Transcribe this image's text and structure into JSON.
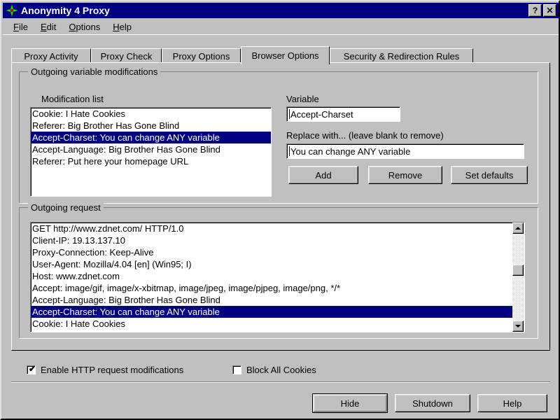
{
  "window": {
    "title": "Anonymity 4 Proxy",
    "icon": "compass-star-icon",
    "help_button": "?",
    "close_button": "✕",
    "titlebar_color": "#000080"
  },
  "menu": {
    "items": [
      {
        "label": "File",
        "accel": "F"
      },
      {
        "label": "Edit",
        "accel": "E"
      },
      {
        "label": "Options",
        "accel": "O"
      },
      {
        "label": "Help",
        "accel": "H"
      }
    ]
  },
  "tabs": [
    {
      "label": "Proxy Activity",
      "active": false
    },
    {
      "label": "Proxy Check",
      "active": false
    },
    {
      "label": "Proxy Options",
      "active": false
    },
    {
      "label": "Browser Options",
      "active": true
    },
    {
      "label": "Security & Redirection Rules",
      "active": false
    }
  ],
  "outgoing_modifications": {
    "group_title": "Outgoing variable modifications",
    "modification_list": {
      "label": "Modification list",
      "items": [
        {
          "text": "Cookie: I Hate Cookies",
          "selected": false
        },
        {
          "text": "Referer: Big Brother Has Gone Blind",
          "selected": false
        },
        {
          "text": "Accept-Charset: You can change ANY variable",
          "selected": true
        },
        {
          "text": "Accept-Language: Big Brother Has Gone Blind",
          "selected": false
        },
        {
          "text": "Referer: Put here your homepage URL",
          "selected": false
        }
      ]
    },
    "variable": {
      "label": "Variable",
      "value": "Accept-Charset",
      "placeholder": ""
    },
    "replace_with": {
      "label": "Replace with... (leave blank to remove)",
      "value": "You can change ANY variable",
      "placeholder": ""
    },
    "buttons": {
      "add": "Add",
      "remove": "Remove",
      "set_defaults": "Set defaults"
    }
  },
  "outgoing_request": {
    "group_title": "Outgoing request",
    "lines": [
      {
        "text": "GET http://www.zdnet.com/ HTTP/1.0",
        "selected": false
      },
      {
        "text": "Client-IP: 19.13.137.10",
        "selected": false
      },
      {
        "text": "Proxy-Connection: Keep-Alive",
        "selected": false
      },
      {
        "text": "User-Agent: Mozilla/4.04 [en] (Win95; I)",
        "selected": false
      },
      {
        "text": "Host: www.zdnet.com",
        "selected": false
      },
      {
        "text": "Accept: image/gif, image/x-xbitmap, image/jpeg, image/pjpeg, image/png, */*",
        "selected": false
      },
      {
        "text": "Accept-Language: Big Brother Has Gone Blind",
        "selected": false
      },
      {
        "text": "Accept-Charset: You can change ANY variable",
        "selected": true
      },
      {
        "text": "Cookie: I Hate Cookies",
        "selected": false
      }
    ],
    "scrollbar": {
      "up_arrow": "▲",
      "down_arrow": "▼"
    }
  },
  "checkboxes": [
    {
      "label": "Enable HTTP request modifications",
      "checked": true,
      "mark": "✔"
    },
    {
      "label": "Block All Cookies",
      "checked": false,
      "mark": ""
    }
  ],
  "footer_buttons": {
    "hide": "Hide",
    "shutdown": "Shutdown",
    "help": "Help"
  }
}
